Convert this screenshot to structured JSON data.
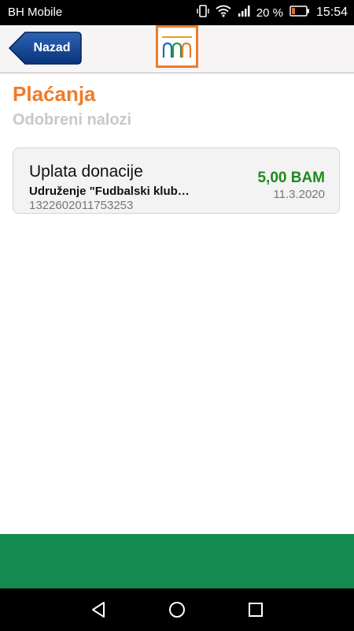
{
  "status_bar": {
    "carrier": "BH Mobile",
    "battery_percent": "20 %",
    "time": "15:54"
  },
  "header": {
    "back_label": "Nazad",
    "colors": {
      "back_button": "#0c3f8a",
      "logo_border": "#ef7b2a"
    }
  },
  "page": {
    "title": "Plaćanja",
    "subtitle": "Odobreni nalozi"
  },
  "payments": [
    {
      "name": "Uplata donacije",
      "recipient": "Udruženje \"Fudbalski klub…",
      "account": "1322602011753253",
      "amount": "5,00 BAM",
      "date": "11.3.2020"
    }
  ],
  "colors": {
    "title": "#ef7b2a",
    "amount": "#1e8a1e",
    "footer": "#138a50"
  }
}
